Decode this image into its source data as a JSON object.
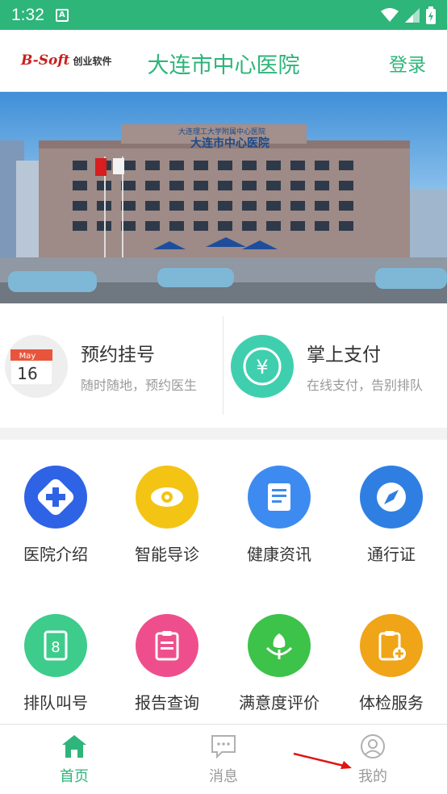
{
  "status_bar": {
    "time": "1:32",
    "notification_badge": "A"
  },
  "header": {
    "logo_mark": "B-Soft",
    "logo_text": "创业软件",
    "title": "大连市中心医院",
    "login_label": "登录"
  },
  "banner": {
    "sign_text": "大连市中心医院",
    "sign_subtext": "大连理工大学附属中心医院"
  },
  "quick_actions": [
    {
      "title": "预约挂号",
      "subtitle": "随时随地，预约医生",
      "icon": "calendar-icon",
      "calendar_month": "May",
      "calendar_day": "16"
    },
    {
      "title": "掌上支付",
      "subtitle": "在线支付，告别排队",
      "icon": "yen-icon",
      "symbol": "¥"
    }
  ],
  "services": [
    {
      "label": "医院介绍",
      "icon": "hospital-plus-icon",
      "color": "#2f63e6"
    },
    {
      "label": "智能导诊",
      "icon": "eye-icon",
      "color": "#f3c413"
    },
    {
      "label": "健康资讯",
      "icon": "document-icon",
      "color": "#3d8bf0"
    },
    {
      "label": "通行证",
      "icon": "compass-icon",
      "color": "#2f7fe3"
    },
    {
      "label": "排队叫号",
      "icon": "queue-icon",
      "color": "#3dcc8c",
      "glyph": "8"
    },
    {
      "label": "报告查询",
      "icon": "clipboard-icon",
      "color": "#ee4f8c"
    },
    {
      "label": "满意度评价",
      "icon": "flower-icon",
      "color": "#3dc24a"
    },
    {
      "label": "体检服务",
      "icon": "checkup-icon",
      "color": "#f0a417"
    }
  ],
  "tab_bar": [
    {
      "label": "首页",
      "icon": "home-icon",
      "active": true
    },
    {
      "label": "消息",
      "icon": "message-icon",
      "active": false
    },
    {
      "label": "我的",
      "icon": "user-icon",
      "active": false
    }
  ],
  "colors": {
    "accent": "#2db57a",
    "annotation_arrow": "#e01414"
  }
}
